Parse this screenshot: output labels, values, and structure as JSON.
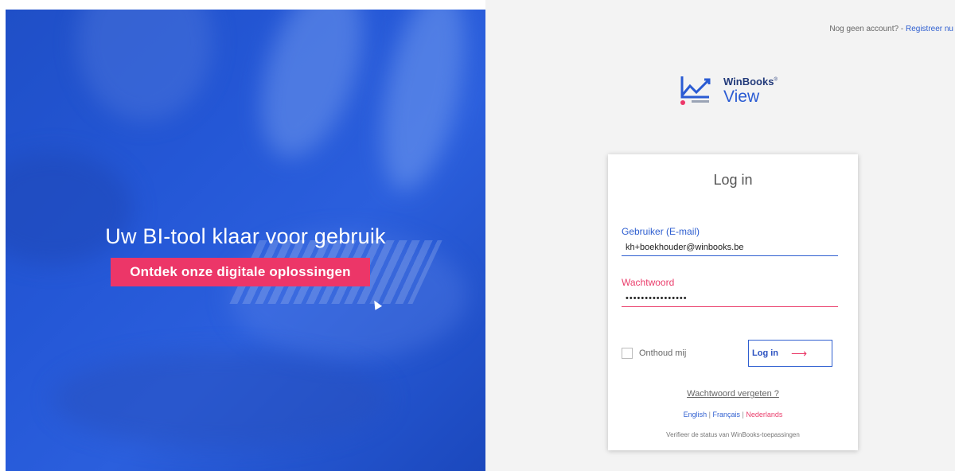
{
  "hero": {
    "title": "Uw BI-tool klaar voor gebruik",
    "cta": "Ontdek onze digitale oplossingen"
  },
  "header": {
    "prompt": "Nog geen account? - ",
    "register_link": "Registreer nu"
  },
  "logo": {
    "brand": "WinBooks",
    "product": "View"
  },
  "login": {
    "title": "Log in",
    "user_label": "Gebruiker (E-mail)",
    "user_value": "kh+boekhouder@winbooks.be",
    "password_label": "Wachtwoord",
    "password_value": "••••••••••••••••",
    "remember_label": "Onthoud mij",
    "submit_label": "Log in",
    "forgot_link": "Wachtwoord vergeten ?",
    "languages": [
      "English",
      "Français",
      "Nederlands"
    ],
    "active_language": "Nederlands",
    "status_link": "Verifieer de status van WinBooks-toepassingen"
  },
  "colors": {
    "primary_blue": "#2f5fd0",
    "accent_pink": "#ec3668",
    "hero_blue": "#2457d6"
  },
  "icons": {
    "submit_arrow": "arrow-right-icon",
    "logo_mark": "chart-line-icon"
  }
}
